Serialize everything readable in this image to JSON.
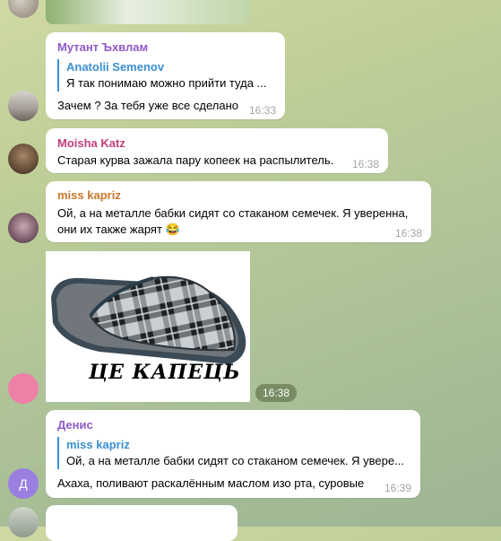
{
  "colors": {
    "mutant": "#8e5ac7",
    "moisha": "#c2407a",
    "miss": "#c8762c",
    "denis": "#8e5ac7",
    "reply_accent": "#3a8fd0"
  },
  "messages": [
    {
      "sender": "Мутант Ъхвлам",
      "reply_name": "Anatolii Semenov",
      "reply_text": "Я так понимаю можно прийти туда ...",
      "text": "Зачем ? За тебя уже все сделано",
      "time": "16:33"
    },
    {
      "sender": "Moisha Katz",
      "text": "Старая курва зажала пару копеек на распылитель.",
      "time": "16:38"
    },
    {
      "sender": "miss kapriz",
      "text_line1": "Ой, а на металле бабки сидят со стаканом семечек. Я уверенна,",
      "text_line2": "они их также жарят 😂",
      "time": "16:38"
    },
    {
      "image_caption": "ЦЕ КАПЕЦЬ",
      "time": "16:38"
    },
    {
      "sender": "Денис",
      "reply_name": "miss kapriz",
      "reply_text": "Ой, а на металле бабки сидят со стаканом семечек. Я увере...",
      "text": "Ахаха, поливают раскалённым маслом изо рта, суровые",
      "time": "16:39",
      "avatar_letter": "Д"
    }
  ]
}
